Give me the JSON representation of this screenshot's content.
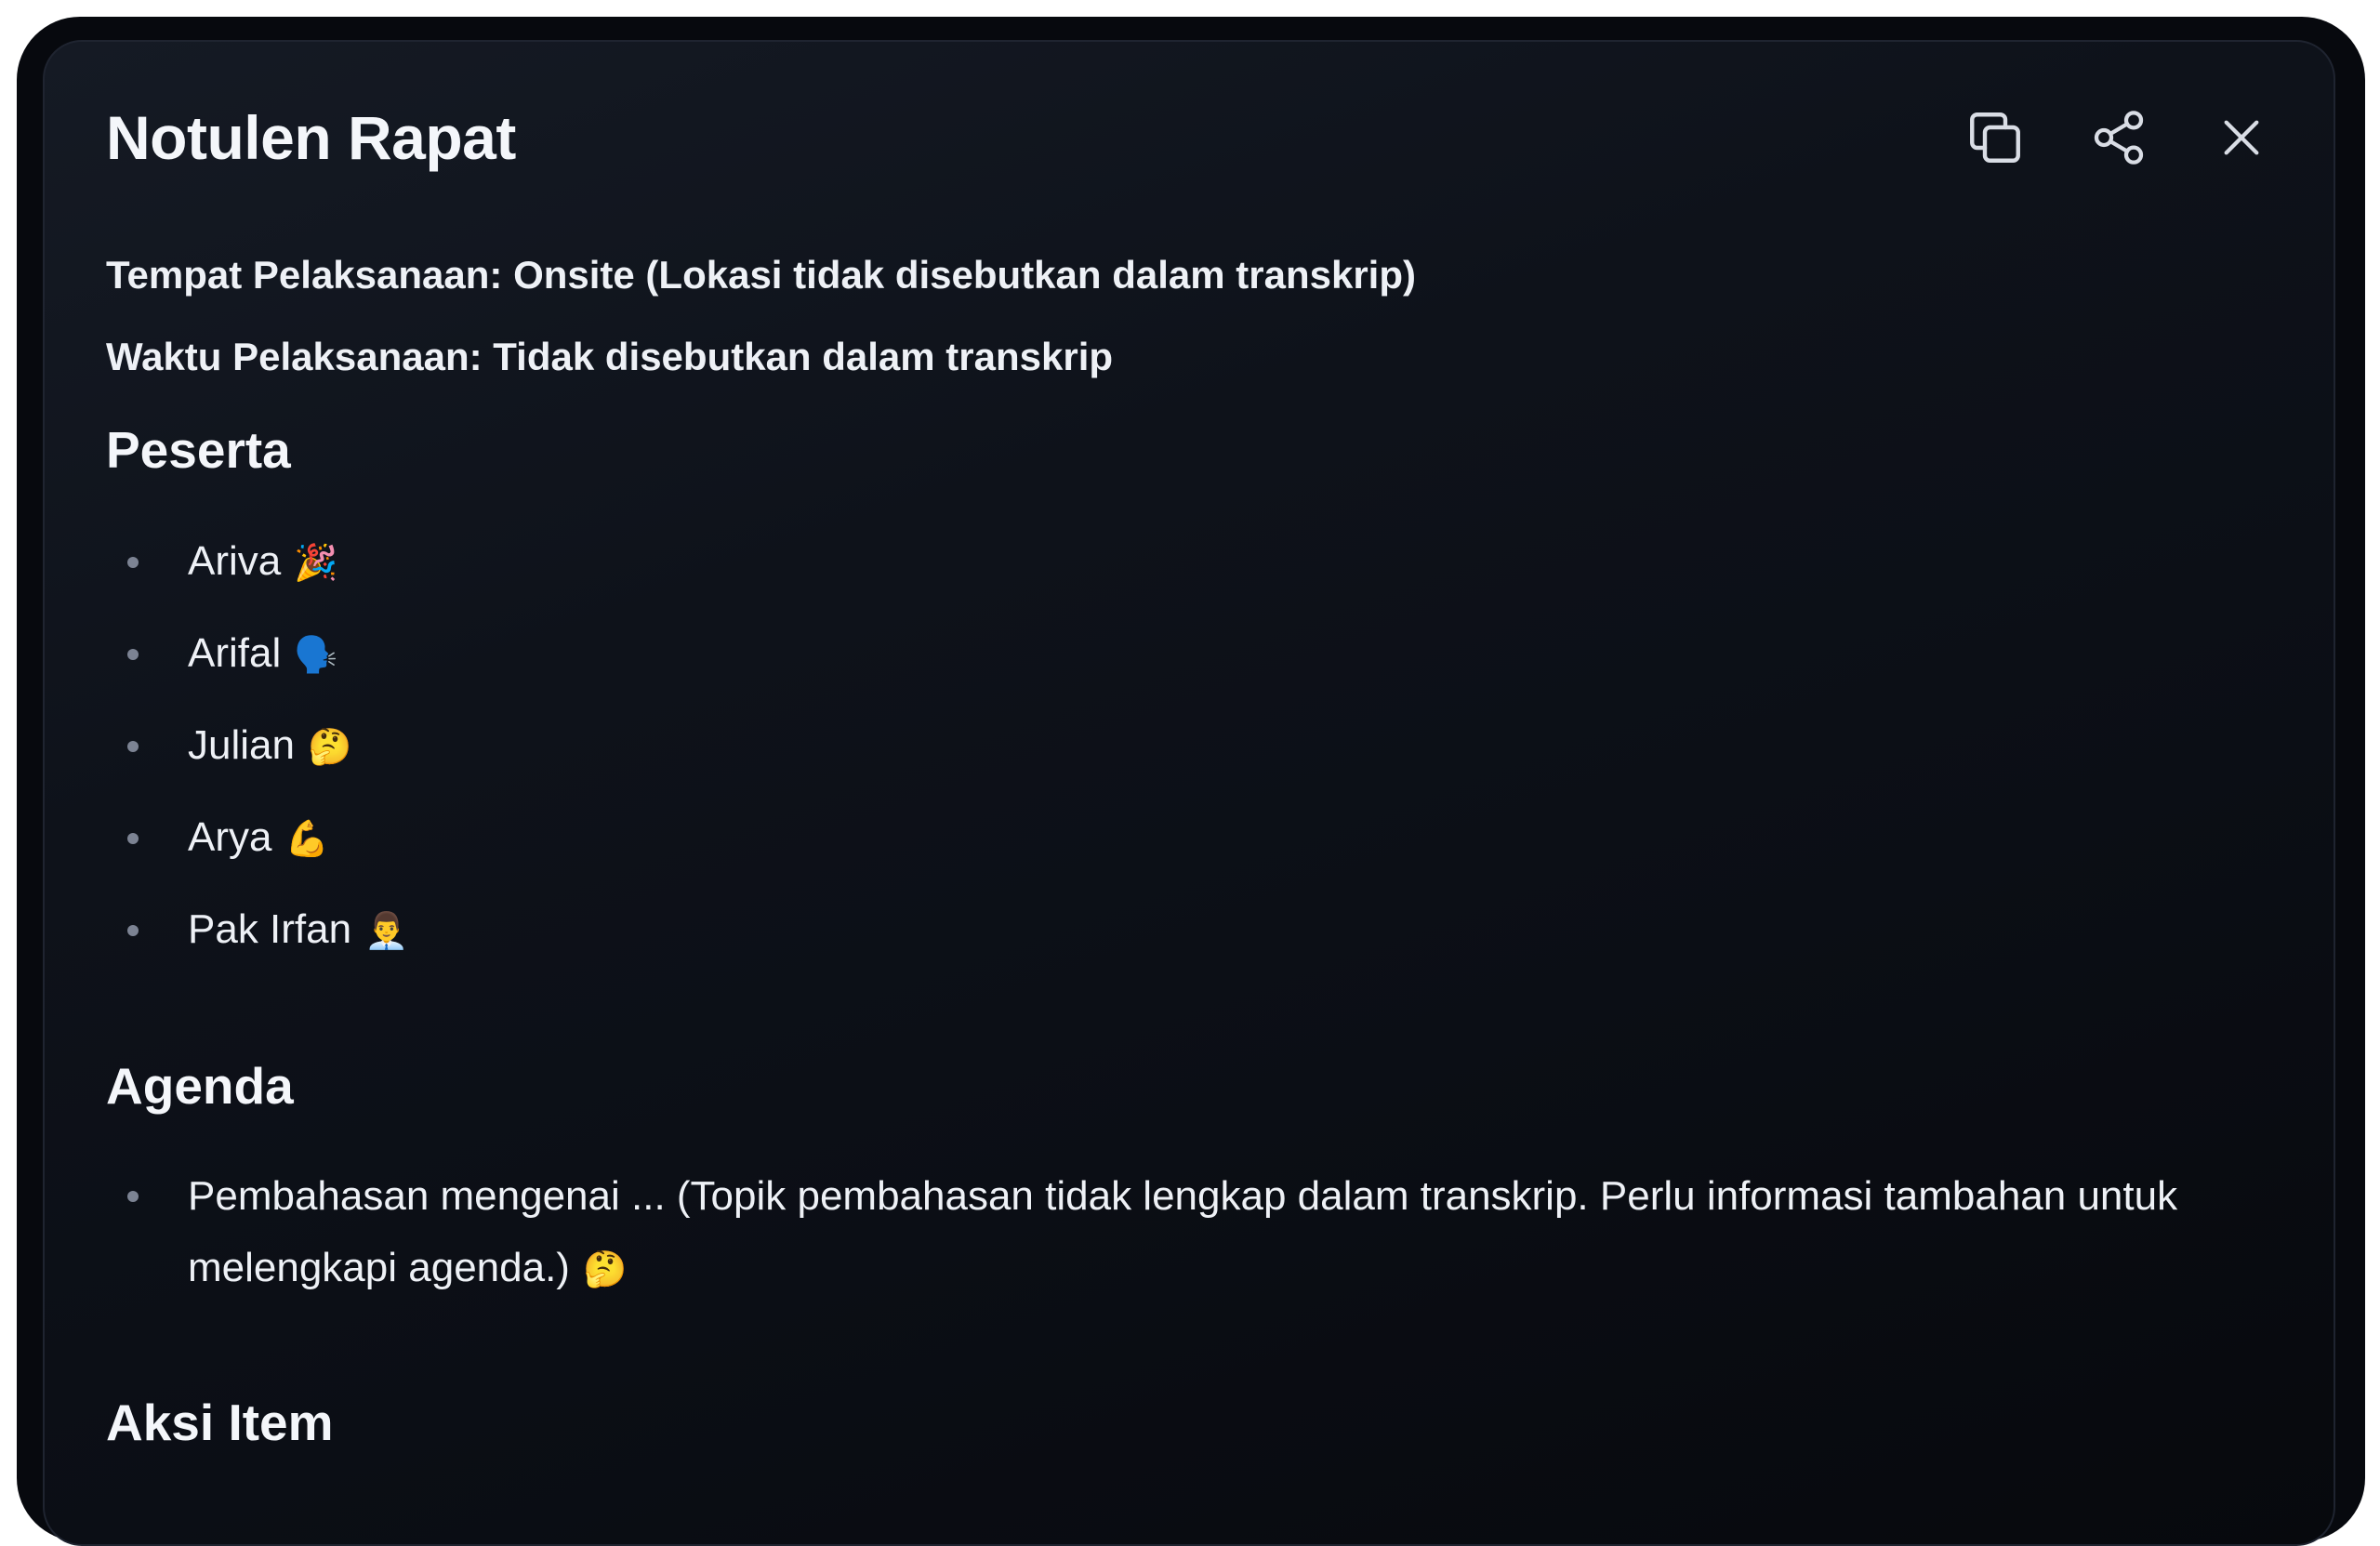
{
  "title": "Notulen Rapat",
  "toolbar": {
    "icons": [
      "copy-icon",
      "share-icon",
      "close-icon"
    ],
    "icon_color": "#d9dde5"
  },
  "meta": {
    "location": "Tempat Pelaksanaan: Onsite (Lokasi tidak disebutkan dalam transkrip)",
    "time": "Waktu Pelaksanaan: Tidak disebutkan dalam transkrip"
  },
  "participants": {
    "heading": "Peserta",
    "items": [
      {
        "name": "Ariva",
        "emoji": "🎉"
      },
      {
        "name": "Arifal",
        "emoji": "🗣️"
      },
      {
        "name": "Julian",
        "emoji": "🤔"
      },
      {
        "name": "Arya",
        "emoji": "💪"
      },
      {
        "name": "Pak Irfan",
        "emoji": "👨‍💼"
      }
    ]
  },
  "agenda": {
    "heading": "Agenda",
    "items": [
      {
        "text": "Pembahasan mengenai ... (Topik pembahasan tidak lengkap dalam transkrip. Perlu informasi tambahan untuk melengkapi agenda.)",
        "emoji": "🤔"
      }
    ]
  },
  "action_items": {
    "heading": "Aksi Item"
  },
  "colors": {
    "background": "#0b0e15",
    "text": "#eef1f6",
    "bullet": "#7c8393"
  }
}
